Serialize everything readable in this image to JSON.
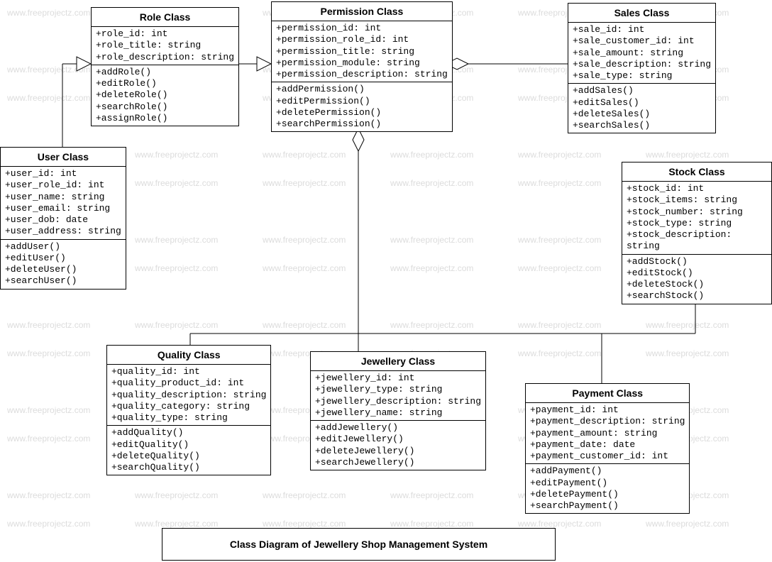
{
  "caption": "Class Diagram of Jewellery Shop Management System",
  "watermark": "www.freeprojectz.com",
  "classes": {
    "role": {
      "title": "Role Class",
      "attrs": [
        "+role_id: int",
        "+role_title: string",
        "+role_description: string"
      ],
      "ops": [
        "+addRole()",
        "+editRole()",
        "+deleteRole()",
        "+searchRole()",
        "+assignRole()"
      ]
    },
    "permission": {
      "title": "Permission Class",
      "attrs": [
        "+permission_id: int",
        "+permission_role_id: int",
        "+permission_title: string",
        "+permission_module: string",
        "+permission_description: string"
      ],
      "ops": [
        "+addPermission()",
        "+editPermission()",
        "+deletePermission()",
        "+searchPermission()"
      ]
    },
    "sales": {
      "title": "Sales Class",
      "attrs": [
        "+sale_id: int",
        "+sale_customer_id: int",
        "+sale_amount: string",
        "+sale_description: string",
        "+sale_type: string"
      ],
      "ops": [
        "+addSales()",
        "+editSales()",
        "+deleteSales()",
        "+searchSales()"
      ]
    },
    "user": {
      "title": "User Class",
      "attrs": [
        "+user_id: int",
        "+user_role_id: int",
        "+user_name: string",
        "+user_email: string",
        "+user_dob: date",
        "+user_address: string"
      ],
      "ops": [
        "+addUser()",
        "+editUser()",
        "+deleteUser()",
        "+searchUser()"
      ]
    },
    "stock": {
      "title": "Stock Class",
      "attrs": [
        "+stock_id: int",
        "+stock_items: string",
        "+stock_number: string",
        "+stock_type: string",
        "+stock_description: string"
      ],
      "ops": [
        "+addStock()",
        "+editStock()",
        "+deleteStock()",
        "+searchStock()"
      ]
    },
    "quality": {
      "title": "Quality Class",
      "attrs": [
        "+quality_id: int",
        "+quality_product_id: int",
        "+quality_description: string",
        "+quality_category: string",
        "+quality_type: string"
      ],
      "ops": [
        "+addQuality()",
        "+editQuality()",
        "+deleteQuality()",
        "+searchQuality()"
      ]
    },
    "jewellery": {
      "title": "Jewellery Class",
      "attrs": [
        "+jewellery_id: int",
        "+jewellery_type: string",
        "+jewellery_description: string",
        "+jewellery_name: string"
      ],
      "ops": [
        "+addJewellery()",
        "+editJewellery()",
        "+deleteJewellery()",
        "+searchJewellery()"
      ]
    },
    "payment": {
      "title": "Payment Class",
      "attrs": [
        "+payment_id: int",
        "+payment_description: string",
        "+payment_amount: string",
        "+payment_date: date",
        "+payment_customer_id: int"
      ],
      "ops": [
        "+addPayment()",
        "+editPayment()",
        "+deletePayment()",
        "+searchPayment()"
      ]
    }
  }
}
